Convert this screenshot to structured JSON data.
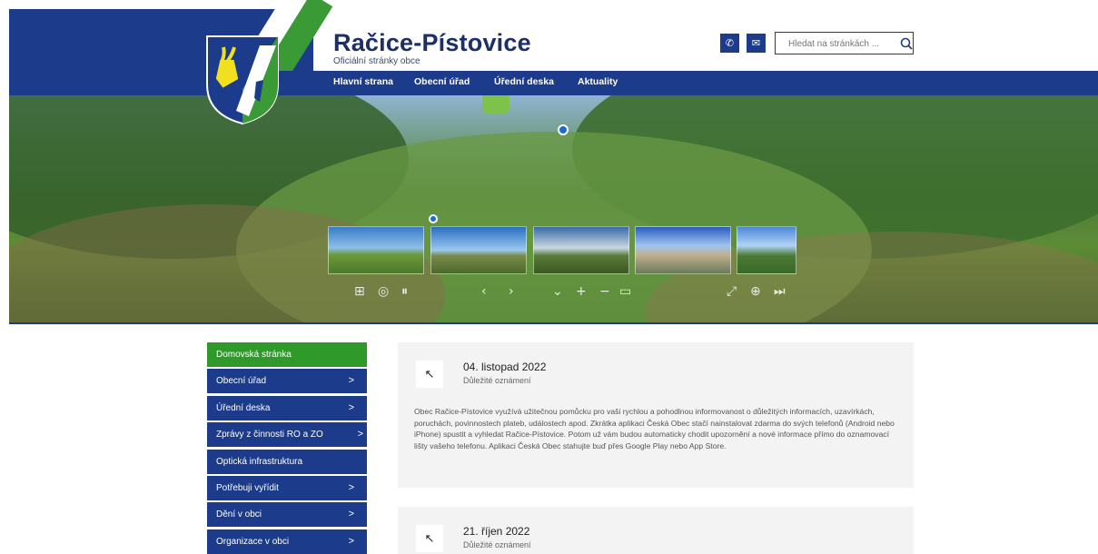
{
  "header": {
    "site_title": "Račice-Pístovice",
    "site_subtitle": "Oficiální stránky obce",
    "phone_icon": "phone-icon",
    "mail_icon": "mail-icon",
    "search_placeholder": "Hledat na stránkách ...",
    "search_icon": "search-icon"
  },
  "nav": {
    "items": [
      {
        "label": "Hlavní strana"
      },
      {
        "label": "Obecní úřad"
      },
      {
        "label": "Úřední deska"
      },
      {
        "label": "Aktuality"
      }
    ]
  },
  "sidebar": {
    "items": [
      {
        "label": "Domovská stránka",
        "active": true
      },
      {
        "label": "Obecní úřad",
        "chevron": ">"
      },
      {
        "label": "Úřední deska",
        "chevron": ">"
      },
      {
        "label": "Zprávy z činnosti RO a ZO",
        "chevron": ">"
      },
      {
        "label": "Optická infrastruktura"
      },
      {
        "label": "Potřebuji vyřídit",
        "chevron": ">"
      },
      {
        "label": "Dění v obci",
        "chevron": ">"
      },
      {
        "label": "Organizace v obci",
        "chevron": ">"
      }
    ]
  },
  "news": [
    {
      "arrow": "↖",
      "date": "04. listopad 2022",
      "category": "Důležité oznámení",
      "text": "Obec Račice-Pístovice využívá užitečnou pomůcku pro vaši rychlou a pohodlnou informovanost o důležitých informacích, uzavírkách, poruchách, povinnostech plateb, událostech apod. Zkrátka aplikaci Česká Obec stačí nainstalovat zdarma do svých telefonů (Android nebo iPhone) spustit a vyhledat Račice-Pístovice. Potom už vám budou automaticky chodit upozornění a nové informace přímo do oznamovací lišty vašeho telefonu. Aplikaci Česká Obec stahujte buď přes Google Play nebo App Store."
    },
    {
      "arrow": "↖",
      "date": "21. říjen 2022",
      "category": "Důležité oznámení"
    }
  ],
  "colors": {
    "brand_blue": "#1c3b8a",
    "brand_green": "#2f9a2a"
  }
}
